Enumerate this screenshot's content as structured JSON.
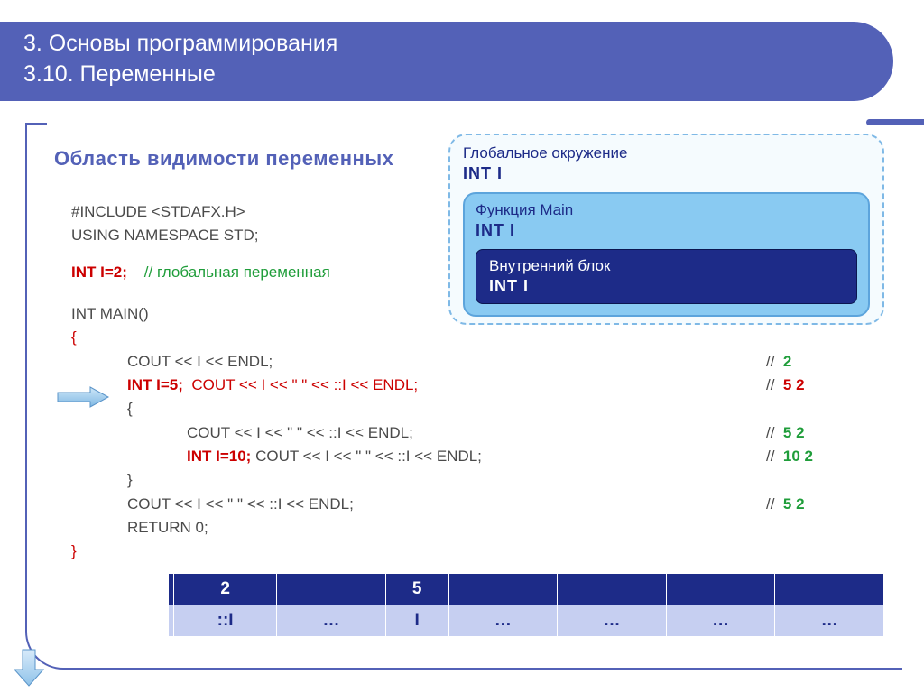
{
  "header": {
    "line1": "3. Основы программирования",
    "line2": "3.10. Переменные"
  },
  "section_title": "Область видимости переменных",
  "scope": {
    "global_label": "Глобальное окружение",
    "global_decl": "INT  I",
    "main_label": "Функция Main",
    "main_decl": "INT  I",
    "inner_label": "Внутренний блок",
    "inner_decl": "INT  I"
  },
  "code": {
    "l1": "#INCLUDE <STDAFX.H>",
    "l2": "USING NAMESPACE STD;",
    "l3a": "INT I=2;",
    "l3b": "// глобальная переменная",
    "l4": "INT MAIN()",
    "brace_open": "{",
    "l5": "COUT << I << ENDL;",
    "l5_out_sl": "//",
    "l5_out": "2",
    "l6a": "INT I=5;",
    "l6b": "COUT << I << \"   \" << ::I << ENDL;",
    "l6_out_sl": "//",
    "l6_out": "5    2",
    "inner_open": "{",
    "l7": "COUT << I << \"   \" << ::I << ENDL;",
    "l7_out_sl": "//",
    "l7_out": "5    2",
    "l8a": "INT I=10;",
    "l8b": "COUT << I << \"   \" << ::I << ENDL;",
    "l8_out_sl": "//",
    "l8_out": "10   2",
    "inner_close": "}",
    "l9": "COUT << I << \"   \" << ::I << ENDL;",
    "l9_out_sl": "//",
    "l9_out": "5    2",
    "l10": "RETURN 0;",
    "brace_close": "}"
  },
  "stack": {
    "row1": [
      "",
      "2",
      "",
      "5",
      "",
      "",
      "",
      ""
    ],
    "row2": [
      "",
      "::I",
      "…",
      "I",
      "…",
      "…",
      "…",
      "…"
    ]
  }
}
